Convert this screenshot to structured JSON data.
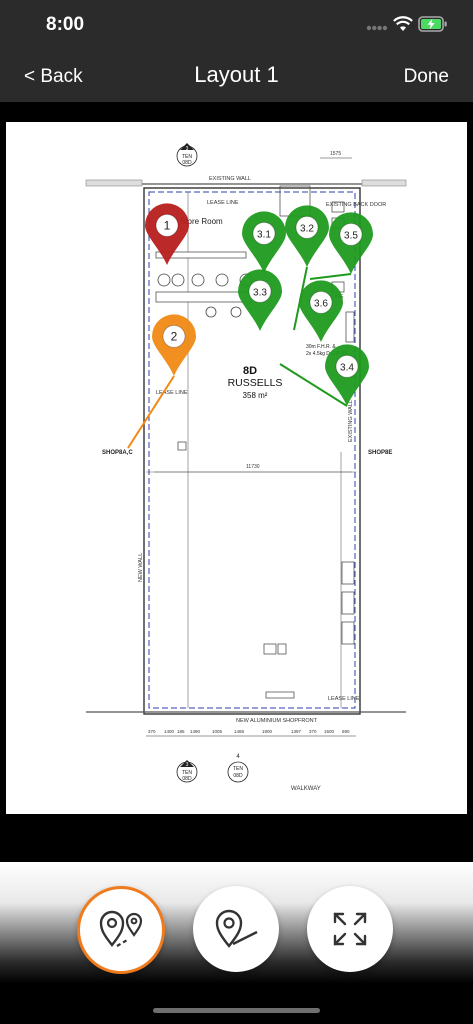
{
  "status": {
    "time": "8:00"
  },
  "nav": {
    "back_label": "< Back",
    "title": "Layout 1",
    "done_label": "Done"
  },
  "plan": {
    "tenancy_no": "8D",
    "tenant": "RUSSELLS",
    "area": "358 m²",
    "store_room": "Store Room",
    "existing_wall": "EXISTING WALL",
    "lease_line": "LEASE LINE",
    "existing_back_door": "EXISTING\nBACK DOOR",
    "shop_left": "SHOP8A,C",
    "shop_right": "SHOP8E",
    "new_wall": "NEW WALL",
    "existing_wall_side": "EXISTING WALL",
    "shopfront": "NEW ALUMINIUM SHOPFRONT",
    "walkway": "WALKWAY",
    "width_dim": "11730",
    "top_dim": "1575",
    "tag_ten": "TEN",
    "tag_num_top": "3",
    "tag_code_top": "08D",
    "tag_num_bottom": "3",
    "tag_code_bottom": "08D",
    "tag_four": "4",
    "tag_four_ten": "TEN",
    "tag_four_code": "08D",
    "fire_note_1": "30m F.H.R. &",
    "fire_note_2": "2x 4.5kg D.C.P. FE",
    "bottom_dims": [
      "370",
      "1400",
      "185",
      "1490",
      "1005",
      "1488",
      "1900",
      "1397",
      "370",
      "1500",
      "690"
    ]
  },
  "pins": [
    {
      "label": "1",
      "color": "#b81d1d"
    },
    {
      "label": "2",
      "color": "#f08a14"
    },
    {
      "label": "3.1",
      "color": "#1f9a1f"
    },
    {
      "label": "3.2",
      "color": "#1f9a1f"
    },
    {
      "label": "3.5",
      "color": "#1f9a1f"
    },
    {
      "label": "3.3",
      "color": "#1f9a1f"
    },
    {
      "label": "3.6",
      "color": "#1f9a1f"
    },
    {
      "label": "3.4",
      "color": "#1f9a1f"
    }
  ],
  "toolbar": {
    "accent": "#f07b1d"
  }
}
